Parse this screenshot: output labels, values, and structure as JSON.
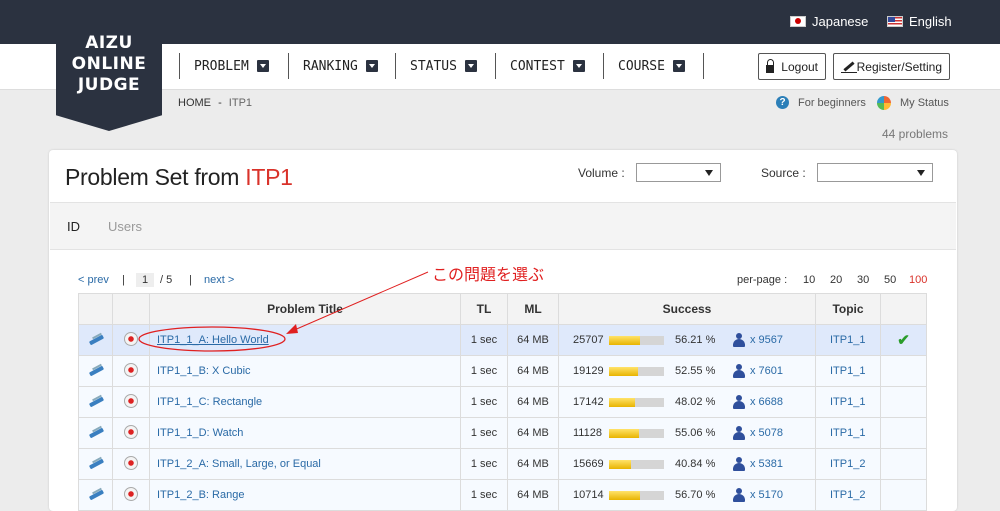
{
  "header": {
    "logo_lines": [
      "AIZU",
      "ONLINE",
      "JUDGE"
    ],
    "languages": [
      "Japanese",
      "English"
    ],
    "menu": [
      "PROBLEM",
      "RANKING",
      "STATUS",
      "CONTEST",
      "COURSE"
    ],
    "logout_label": "Logout",
    "register_label": "Register/Setting"
  },
  "breadcrumb": {
    "home": "HOME",
    "separator": "-",
    "current": "ITP1"
  },
  "help": {
    "beginners": "For beginners",
    "status": "My Status"
  },
  "problem_count": "44 problems",
  "panel": {
    "title_prefix": "Problem Set from ",
    "title_accent": "ITP1",
    "volume_label": "Volume :",
    "source_label": "Source :",
    "tabs": [
      "ID",
      "Users"
    ]
  },
  "pagination": {
    "prev": "< prev",
    "pipe": "|",
    "current": "1",
    "total": "/ 5",
    "next": "next >",
    "per_page_label": "per-page :",
    "per_page_options": [
      "10",
      "20",
      "30",
      "50",
      "100"
    ]
  },
  "annotation": "この問題を選ぶ",
  "colors": {
    "accent": "#d9322a",
    "topbar": "#2b3240",
    "link": "#2a6aa6"
  },
  "table": {
    "headers": [
      "",
      "",
      "Problem Title",
      "TL",
      "ML",
      "Success",
      "Topic"
    ],
    "rows": [
      {
        "title": "ITP1_1_A:   Hello World",
        "tl": "1 sec",
        "ml": "64 MB",
        "solved": "25707",
        "rate": 56.21,
        "pct": "56.21 %",
        "users": "x 9567",
        "topic": "ITP1_1",
        "done": "✔"
      },
      {
        "title": "ITP1_1_B:   X Cubic",
        "tl": "1 sec",
        "ml": "64 MB",
        "solved": "19129",
        "rate": 52.55,
        "pct": "52.55 %",
        "users": "x 7601",
        "topic": "ITP1_1",
        "done": ""
      },
      {
        "title": "ITP1_1_C:   Rectangle",
        "tl": "1 sec",
        "ml": "64 MB",
        "solved": "17142",
        "rate": 48.02,
        "pct": "48.02 %",
        "users": "x 6688",
        "topic": "ITP1_1",
        "done": ""
      },
      {
        "title": "ITP1_1_D:   Watch",
        "tl": "1 sec",
        "ml": "64 MB",
        "solved": "11128",
        "rate": 55.06,
        "pct": "55.06 %",
        "users": "x 5078",
        "topic": "ITP1_1",
        "done": ""
      },
      {
        "title": "ITP1_2_A:   Small, Large, or Equal",
        "tl": "1 sec",
        "ml": "64 MB",
        "solved": "15669",
        "rate": 40.84,
        "pct": "40.84 %",
        "users": "x 5381",
        "topic": "ITP1_2",
        "done": ""
      },
      {
        "title": "ITP1_2_B:   Range",
        "tl": "1 sec",
        "ml": "64 MB",
        "solved": "10714",
        "rate": 56.7,
        "pct": "56.70 %",
        "users": "x 5170",
        "topic": "ITP1_2",
        "done": ""
      }
    ]
  }
}
